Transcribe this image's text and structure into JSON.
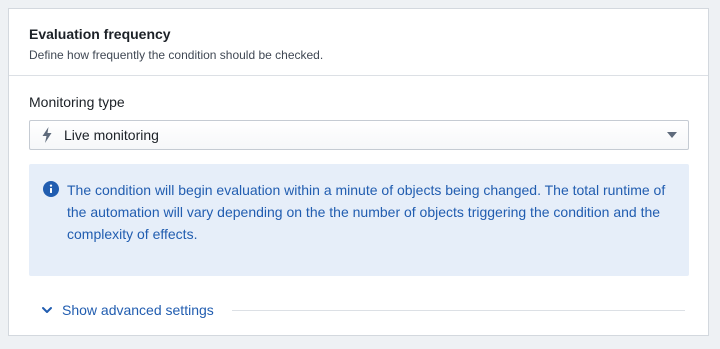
{
  "section": {
    "title": "Evaluation frequency",
    "description": "Define how frequently the condition should be checked."
  },
  "monitoring": {
    "label": "Monitoring type",
    "selected_value": "Live monitoring",
    "selected_icon": "lightning-bolt-icon",
    "caret_icon": "caret-down-icon"
  },
  "callout": {
    "icon": "info-icon",
    "text": "The condition will begin evaluation within a minute of objects being changed. The total runtime of the automation will vary depending on the the number of objects triggering the condition and the complexity of effects."
  },
  "advanced": {
    "label": "Show advanced settings",
    "icon": "chevron-down-icon"
  },
  "colors": {
    "accent": "#215db0",
    "callout_bg": "#e6eef9",
    "page_bg": "#eef1f4"
  }
}
